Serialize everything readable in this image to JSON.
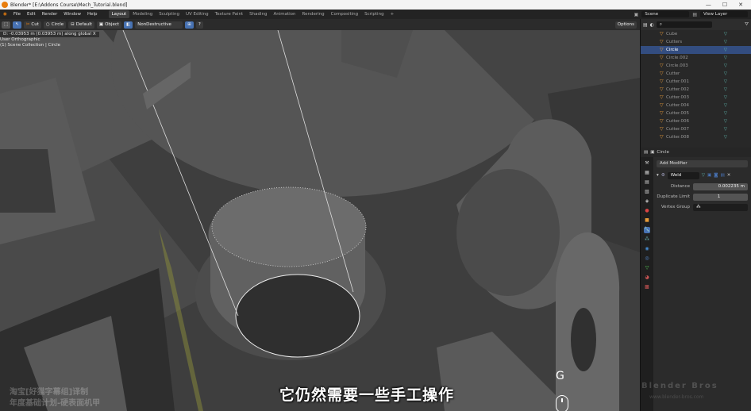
{
  "window": {
    "title": "Blender* [E:\\Addons Course\\Mech_Tutorial.blend]"
  },
  "menu": [
    "File",
    "Edit",
    "Render",
    "Window",
    "Help"
  ],
  "workspaces": [
    "Layout",
    "Modeling",
    "Sculpting",
    "UV Editing",
    "Texture Paint",
    "Shading",
    "Animation",
    "Rendering",
    "Compositing",
    "Scripting"
  ],
  "active_workspace": "Layout",
  "scene": "Scene",
  "view_layer": "View Layer",
  "toolbar": {
    "tool": "Cut",
    "shape": "Circle",
    "mode": "Default",
    "target": "Object",
    "boolean": "NonDestructive",
    "options": "Options"
  },
  "viewport": {
    "status": "D: -0.03953 m (0.03953 m) along global X",
    "view_name": "User Orthographic",
    "collection": "(1) Scene Collection | Circle",
    "key_hint": "G"
  },
  "outliner": {
    "items": [
      {
        "name": "Cube",
        "selected": false
      },
      {
        "name": "Cutters",
        "selected": false
      },
      {
        "name": "Circle",
        "selected": true
      },
      {
        "name": "Circle.002",
        "selected": false
      },
      {
        "name": "Circle.003",
        "selected": false
      },
      {
        "name": "Cutter",
        "selected": false
      },
      {
        "name": "Cutter.001",
        "selected": false
      },
      {
        "name": "Cutter.002",
        "selected": false
      },
      {
        "name": "Cutter.003",
        "selected": false
      },
      {
        "name": "Cutter.004",
        "selected": false
      },
      {
        "name": "Cutter.005",
        "selected": false
      },
      {
        "name": "Cutter.006",
        "selected": false
      },
      {
        "name": "Cutter.007",
        "selected": false
      },
      {
        "name": "Cutter.008",
        "selected": false
      }
    ]
  },
  "properties": {
    "object": "Circle",
    "add_modifier": "Add Modifier",
    "modifier_name": "Weld",
    "distance_label": "Distance",
    "distance_value": "0.002235 m",
    "dup_label": "Duplicate Limit",
    "dup_value": "1",
    "vgroup_label": "Vertex Group"
  },
  "subtitle": "它仍然需要一些手工操作",
  "watermark": {
    "left_line1": "淘宝[好猫字幕组]译制",
    "left_line2": "年度基础计划-硬表面机甲",
    "right": "Blender Bros",
    "right_url": "www.blender-bros.com"
  },
  "colors": {
    "accent": "#4772b3",
    "select": "#334d80",
    "orange": "#e87d0d"
  }
}
